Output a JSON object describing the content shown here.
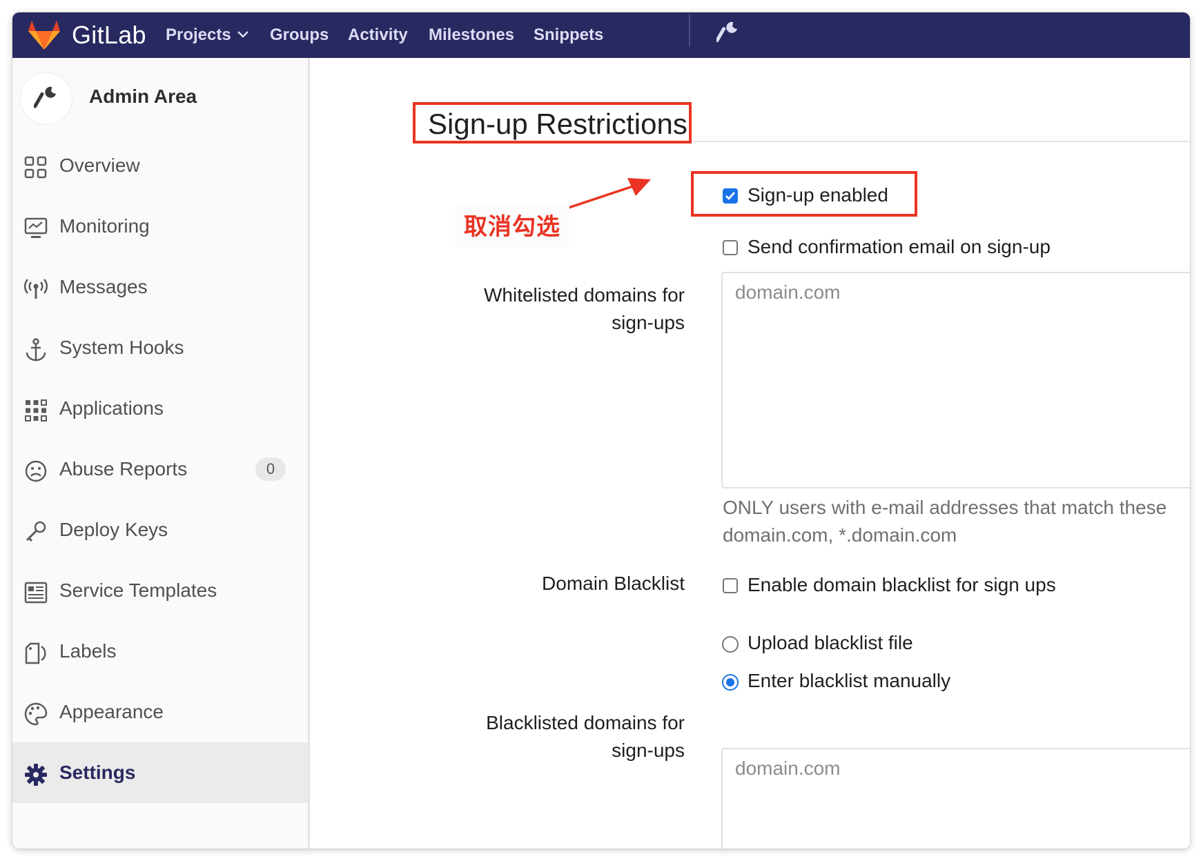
{
  "navbar": {
    "brand": "GitLab",
    "items": [
      {
        "label": "Projects",
        "has_dropdown": true
      },
      {
        "label": "Groups"
      },
      {
        "label": "Activity"
      },
      {
        "label": "Milestones"
      },
      {
        "label": "Snippets"
      }
    ],
    "admin_icon": "wrench-icon",
    "background": "#292961"
  },
  "sidebar": {
    "title": "Admin Area",
    "header_icon": "wrench-icon",
    "items": [
      {
        "label": "Overview",
        "icon": "overview-grid-icon"
      },
      {
        "label": "Monitoring",
        "icon": "monitor-icon"
      },
      {
        "label": "Messages",
        "icon": "broadcast-icon"
      },
      {
        "label": "System Hooks",
        "icon": "anchor-icon"
      },
      {
        "label": "Applications",
        "icon": "apps-grid-icon"
      },
      {
        "label": "Abuse Reports",
        "icon": "sad-face-icon",
        "badge": "0"
      },
      {
        "label": "Deploy Keys",
        "icon": "key-icon"
      },
      {
        "label": "Service Templates",
        "icon": "template-icon"
      },
      {
        "label": "Labels",
        "icon": "label-tag-icon"
      },
      {
        "label": "Appearance",
        "icon": "palette-icon"
      },
      {
        "label": "Settings",
        "icon": "gear-icon",
        "active": true
      }
    ]
  },
  "signup": {
    "title": "Sign-up Restrictions",
    "signup_enabled": {
      "label": "Sign-up enabled",
      "checked": true
    },
    "send_confirmation": {
      "label": "Send confirmation email on sign-up",
      "checked": false
    },
    "whitelist": {
      "label_line1": "Whitelisted domains for",
      "label_line2": "sign-ups",
      "placeholder": "domain.com",
      "help_line1": "ONLY users with e-mail addresses that match these",
      "help_line2": "domain.com, *.domain.com"
    },
    "blacklist": {
      "label": "Domain Blacklist",
      "enable_label": "Enable domain blacklist for sign ups",
      "enable_checked": false,
      "upload_label": "Upload blacklist file",
      "manual_label": "Enter blacklist manually",
      "selected": "manual"
    },
    "blacklisted": {
      "label_line1": "Blacklisted domains for",
      "label_line2": "sign-ups",
      "placeholder": "domain.com"
    }
  },
  "annotation": {
    "text": "取消勾选",
    "color": "#ea3323"
  }
}
